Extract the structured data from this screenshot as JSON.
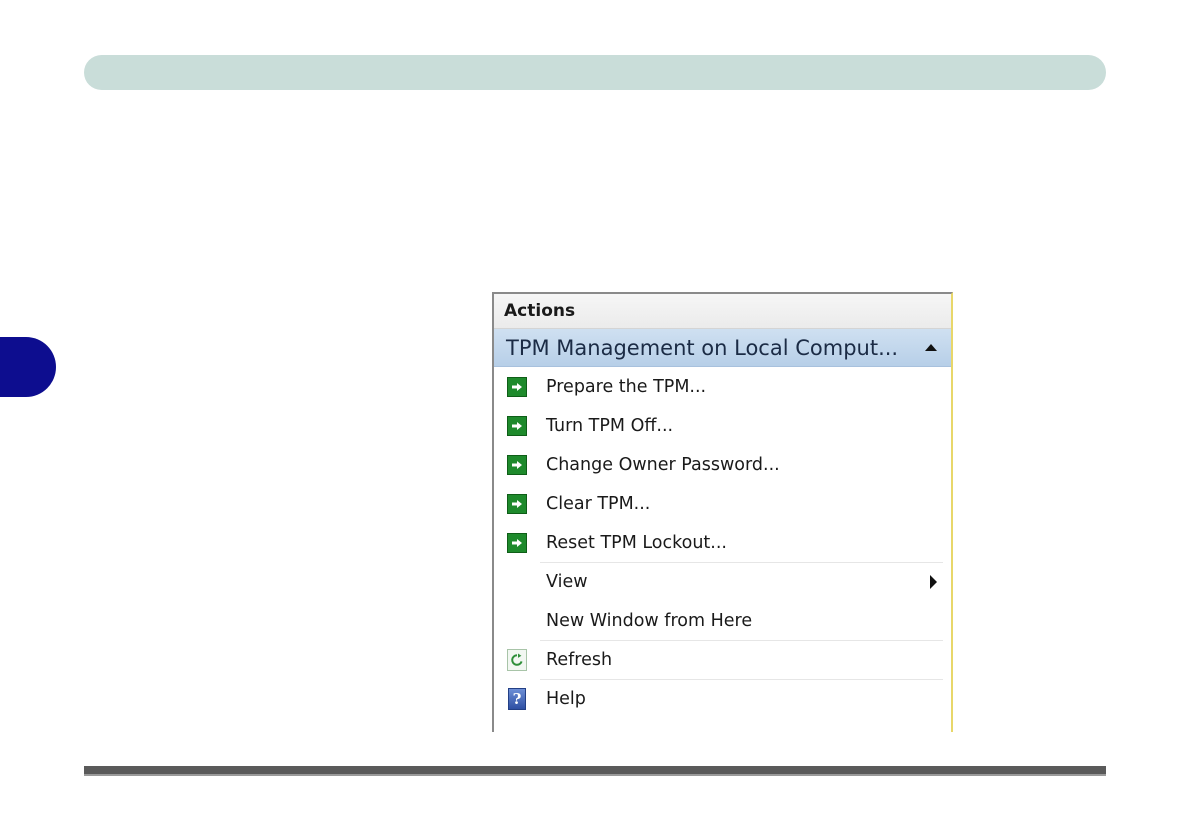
{
  "panel": {
    "title": "Actions",
    "group_title": "TPM Management on Local Comput...",
    "items": [
      {
        "label": "Prepare the TPM...",
        "icon": "green-arrow-icon"
      },
      {
        "label": "Turn TPM Off...",
        "icon": "green-arrow-icon"
      },
      {
        "label": "Change Owner Password...",
        "icon": "green-arrow-icon"
      },
      {
        "label": "Clear TPM...",
        "icon": "green-arrow-icon"
      },
      {
        "label": "Reset TPM Lockout...",
        "icon": "green-arrow-icon"
      },
      {
        "label": "View",
        "icon": "",
        "submenu": true
      },
      {
        "label": "New Window from Here",
        "icon": ""
      },
      {
        "label": "Refresh",
        "icon": "refresh-icon"
      },
      {
        "label": "Help",
        "icon": "help-icon"
      }
    ]
  },
  "colors": {
    "top_bar": "#c9ddd9",
    "side_tab": "#0d0d8f",
    "group_header": "#b7cfe8",
    "action_icon_green": "#1e8a2c"
  }
}
